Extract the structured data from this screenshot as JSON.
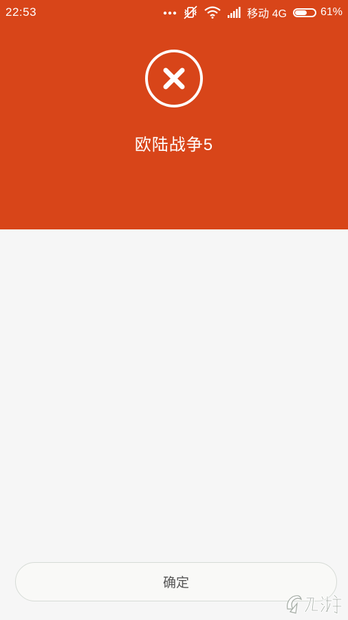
{
  "statusbar": {
    "time": "22:53",
    "dots": "...",
    "carrier": "移动 4G",
    "battery_level": 0.61,
    "battery_percent": "61%"
  },
  "result": {
    "icon": "close-circle-icon",
    "app_name": "欧陆战争5"
  },
  "actions": {
    "confirm_label": "确定"
  },
  "colors": {
    "header_bg": "#d84519",
    "page_bg": "#f6f6f6",
    "button_border": "#d6dbd6"
  },
  "watermark": {
    "text": "九游"
  }
}
